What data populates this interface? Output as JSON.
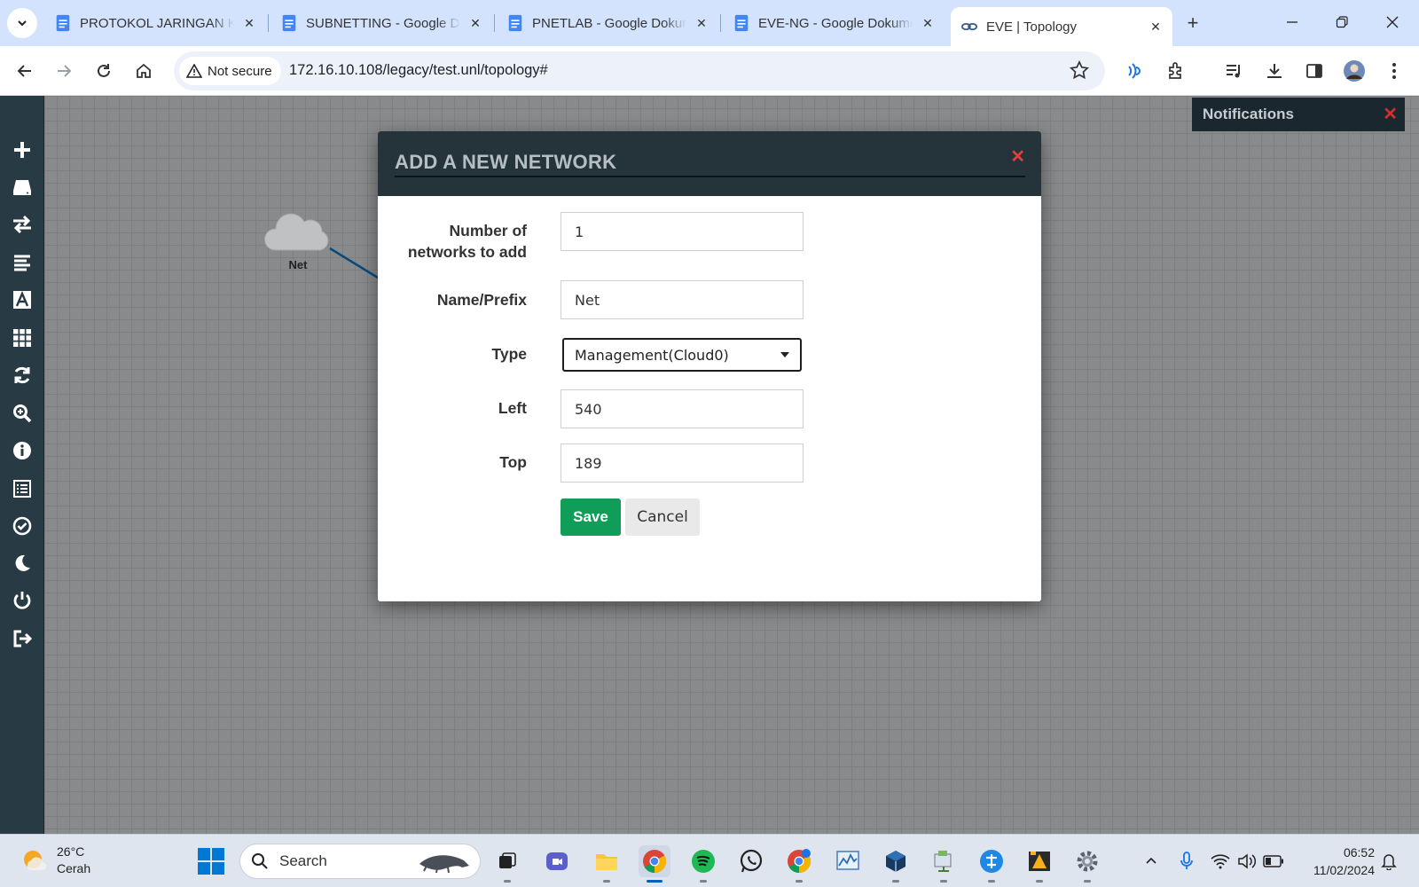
{
  "browser": {
    "tabs": [
      {
        "title": "PROTOKOL JARINGAN KOMPUTER - Google Dokumen",
        "icon": "google-docs-icon",
        "active": false
      },
      {
        "title": "SUBNETTING - Google Dokumen",
        "icon": "google-docs-icon",
        "active": false
      },
      {
        "title": "PNETLAB - Google Dokumen",
        "icon": "google-docs-icon",
        "active": false
      },
      {
        "title": "EVE-NG - Google Dokumen",
        "icon": "google-docs-icon",
        "active": false
      },
      {
        "title": "EVE | Topology",
        "icon": "eve-link-icon",
        "active": true
      }
    ],
    "security_label": "Not secure",
    "url": "172.16.10.108/legacy/test.unl/topology#"
  },
  "sidebar": {
    "items": [
      "add-icon",
      "hdd-icon",
      "exchange-icon",
      "list-icon",
      "text-icon",
      "grid-icon",
      "refresh-icon",
      "zoom-icon",
      "info-icon",
      "list-alt-icon",
      "check-circle-icon",
      "moon-icon",
      "power-icon",
      "logout-icon"
    ]
  },
  "canvas": {
    "node_label": "Net"
  },
  "notifications": {
    "title": "Notifications"
  },
  "modal": {
    "title": "ADD A NEW NETWORK",
    "fields": {
      "count_label_line1": "Number of",
      "count_label_line2": "networks to add",
      "count_value": "1",
      "name_label": "Name/Prefix",
      "name_value": "Net",
      "type_label": "Type",
      "type_value": "Management(Cloud0)",
      "left_label": "Left",
      "left_value": "540",
      "top_label": "Top",
      "top_value": "189"
    },
    "save_label": "Save",
    "cancel_label": "Cancel"
  },
  "taskbar": {
    "weather_temp": "26°C",
    "weather_desc": "Cerah",
    "search_placeholder": "Search",
    "time": "06:52",
    "date": "11/02/2024"
  },
  "colors": {
    "sidebar": "#283a44",
    "modal_header": "#25333b",
    "save": "#0f9d58",
    "close": "#e0413a"
  }
}
